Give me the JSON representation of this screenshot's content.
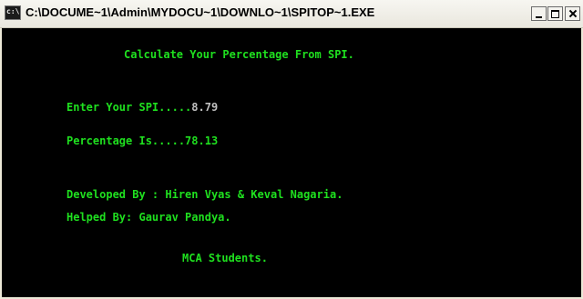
{
  "window": {
    "title": "C:\\DOCUME~1\\Admin\\MYDOCU~1\\DOWNLO~1\\SPITOP~1.EXE"
  },
  "console": {
    "heading": "Calculate Your Percentage From SPI.",
    "spi_label": "Enter Your SPI.....",
    "spi_value": "8.79",
    "percentage_label": "Percentage Is.....",
    "percentage_value": "78.13",
    "developed_by": "Developed By : Hiren Vyas & Keval Nagaria.",
    "helped_by": "Helped By: Gaurav Pandya.",
    "footer": "MCA Students."
  },
  "colors": {
    "console_bg": "#000000",
    "console_text": "#1fe01f",
    "input_text": "#c0c0c0"
  }
}
